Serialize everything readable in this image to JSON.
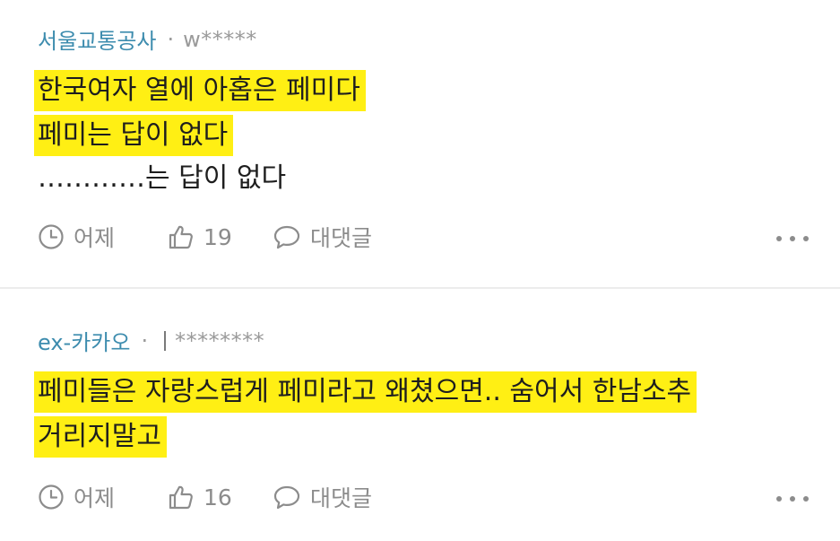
{
  "comments": [
    {
      "author": "서울교통공사",
      "separator": "·",
      "user_id": "w*****",
      "lines": [
        "한국여자 열에 아홉은 페미다",
        "페미는 답이 없다",
        "…………는 답이 없다"
      ],
      "time": "어제",
      "likes": "19",
      "reply_label": "대댓글"
    },
    {
      "author": "ex-카카오",
      "separator": "·",
      "user_id": "********",
      "lines": [
        "페미들은 자랑스럽게 페미라고 왜쳤으면.. 숨어서 한남소추",
        "거리지말고"
      ],
      "time": "어제",
      "likes": "16",
      "reply_label": "대댓글"
    }
  ],
  "highlight_color": "#ffef14",
  "author_color": "#3d8cae",
  "icons": [
    "clock-icon",
    "thumbs-up-icon",
    "speech-bubble-icon",
    "more-icon"
  ]
}
